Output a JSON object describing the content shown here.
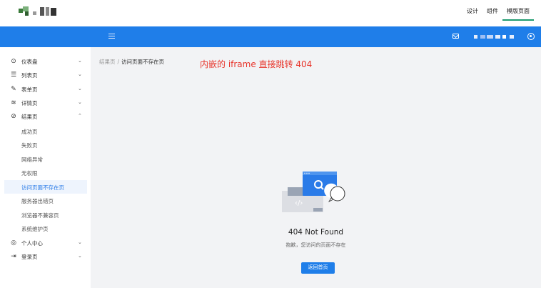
{
  "header": {
    "nav": [
      {
        "label": "设计",
        "active": false
      },
      {
        "label": "组件",
        "active": false
      },
      {
        "label": "模版页面",
        "active": true
      }
    ]
  },
  "sidebar": {
    "items": [
      {
        "label": "仪表盘",
        "icon": "dashboard-icon",
        "arrow": "⌄"
      },
      {
        "label": "列表页",
        "icon": "list-icon",
        "arrow": "⌄"
      },
      {
        "label": "表单页",
        "icon": "pen-icon",
        "arrow": "⌄"
      },
      {
        "label": "详情页",
        "icon": "layers-icon",
        "arrow": "⌄"
      },
      {
        "label": "结果页",
        "icon": "check-circle-icon",
        "arrow": "⌃"
      },
      {
        "label": "个人中心",
        "icon": "user-icon",
        "arrow": "⌄"
      },
      {
        "label": "登录页",
        "icon": "login-icon",
        "arrow": "⌄"
      }
    ],
    "subitems": [
      {
        "label": "成功页"
      },
      {
        "label": "失败页"
      },
      {
        "label": "网络异常"
      },
      {
        "label": "无权限"
      },
      {
        "label": "访问页面不存在页",
        "active": true
      },
      {
        "label": "服务器出错页"
      },
      {
        "label": "浏览器不兼容页"
      },
      {
        "label": "系统维护页"
      }
    ]
  },
  "breadcrumb": {
    "parent": "结果页",
    "separator": "/",
    "current": "访问页面不存在页"
  },
  "annotation": "内嵌的 iframe 直接跳转 404",
  "not_found": {
    "title": "404 Not Found",
    "description": "抱歉，您访问的页面不存在",
    "button": "返回首页"
  },
  "colors": {
    "accent": "#1f7ee9",
    "annotation": "#e8342a",
    "active_tab_underline": "#1e9a6e"
  }
}
